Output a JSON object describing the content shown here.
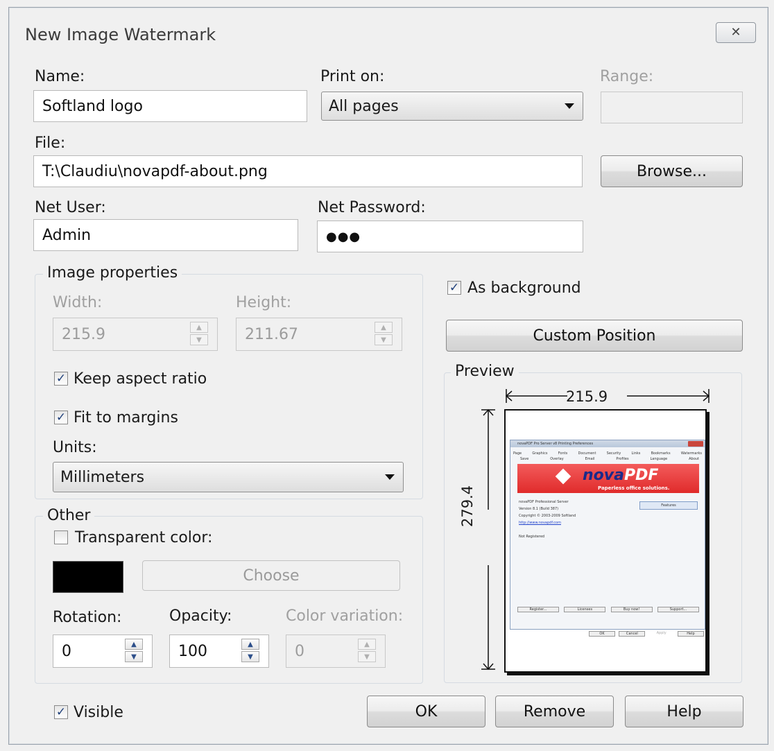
{
  "window": {
    "title": "New Image Watermark",
    "close_glyph": "✕"
  },
  "name": {
    "label": "Name:",
    "value": "Softland logo"
  },
  "print_on": {
    "label": "Print on:",
    "value": "All pages"
  },
  "range": {
    "label": "Range:",
    "value": ""
  },
  "file": {
    "label": "File:",
    "value": "T:\\Claudiu\\novapdf-about.png",
    "browse_label": "Browse..."
  },
  "net_user": {
    "label": "Net User:",
    "value": "Admin"
  },
  "net_password": {
    "label": "Net Password:",
    "value": "●●●"
  },
  "image_properties": {
    "legend": "Image properties",
    "width_label": "Width:",
    "width_value": "215.9",
    "height_label": "Height:",
    "height_value": "211.67",
    "keep_aspect_label": "Keep aspect ratio",
    "keep_aspect_checked": true,
    "fit_margins_label": "Fit to margins",
    "fit_margins_checked": true,
    "units_label": "Units:",
    "units_value": "Millimeters"
  },
  "other": {
    "legend": "Other",
    "transparent_label": "Transparent color:",
    "transparent_checked": false,
    "swatch_color": "#000000",
    "choose_label": "Choose",
    "rotation_label": "Rotation:",
    "rotation_value": "0",
    "opacity_label": "Opacity:",
    "opacity_value": "100",
    "color_variation_label": "Color variation:",
    "color_variation_value": "0"
  },
  "as_background": {
    "label": "As background",
    "checked": true
  },
  "custom_position_label": "Custom Position",
  "preview": {
    "legend": "Preview",
    "width_dim": "215.9",
    "height_dim": "279.4",
    "mini_title": "novaPDF Pro Server v8 Printing Preferences",
    "mini_tabs_row1": [
      "Page",
      "Graphics",
      "Fonts",
      "Document",
      "Security",
      "Links",
      "Bookmarks",
      "Watermarks"
    ],
    "mini_tabs_row2": [
      "Save",
      "Overlay",
      "Email",
      "Profiles",
      "Language",
      "About"
    ],
    "mini_logo_nova": "nova",
    "mini_logo_pdf": "PDF",
    "mini_tagline": "Paperless office solutions.",
    "mini_lines": [
      "novaPDF Professional Server",
      "Version 8.1 (Build 387)",
      "Copyright © 2003-2009 Softland",
      "http://www.novapdf.com",
      "",
      "Not Registered"
    ],
    "mini_features_btn": "Features",
    "mini_bottom_btns": [
      "Register...",
      "Licenses",
      "Buy now!",
      "Support..."
    ],
    "mini_dialog_btns": [
      "OK",
      "Cancel",
      "Apply",
      "Help"
    ]
  },
  "visible": {
    "label": "Visible",
    "checked": true
  },
  "buttons": {
    "ok": "OK",
    "remove": "Remove",
    "help": "Help"
  }
}
